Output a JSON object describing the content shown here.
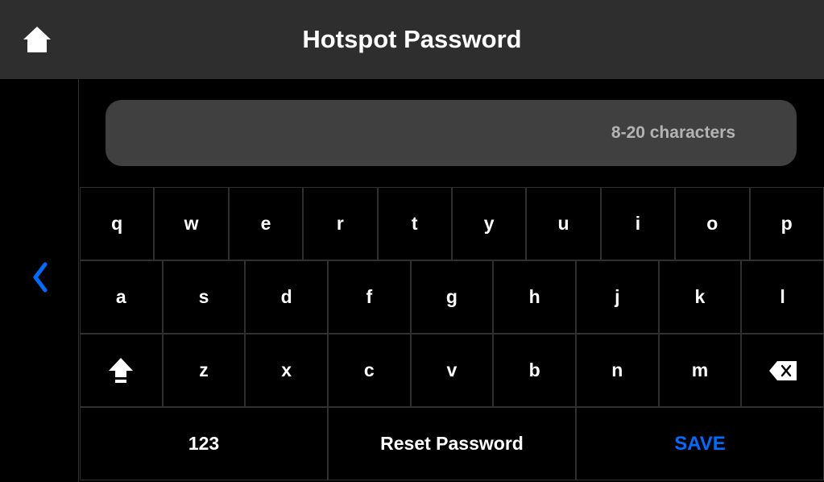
{
  "header": {
    "title": "Hotspot Password"
  },
  "input": {
    "value": "",
    "placeholder": "8-20 characters"
  },
  "keyboard": {
    "row1": [
      "q",
      "w",
      "e",
      "r",
      "t",
      "y",
      "u",
      "i",
      "o",
      "p"
    ],
    "row2": [
      "a",
      "s",
      "d",
      "f",
      "g",
      "h",
      "j",
      "k",
      "l"
    ],
    "row3_letters": [
      "z",
      "x",
      "c",
      "v",
      "b",
      "n",
      "m"
    ],
    "numeric_label": "123",
    "reset_label": "Reset Password",
    "save_label": "SAVE"
  }
}
